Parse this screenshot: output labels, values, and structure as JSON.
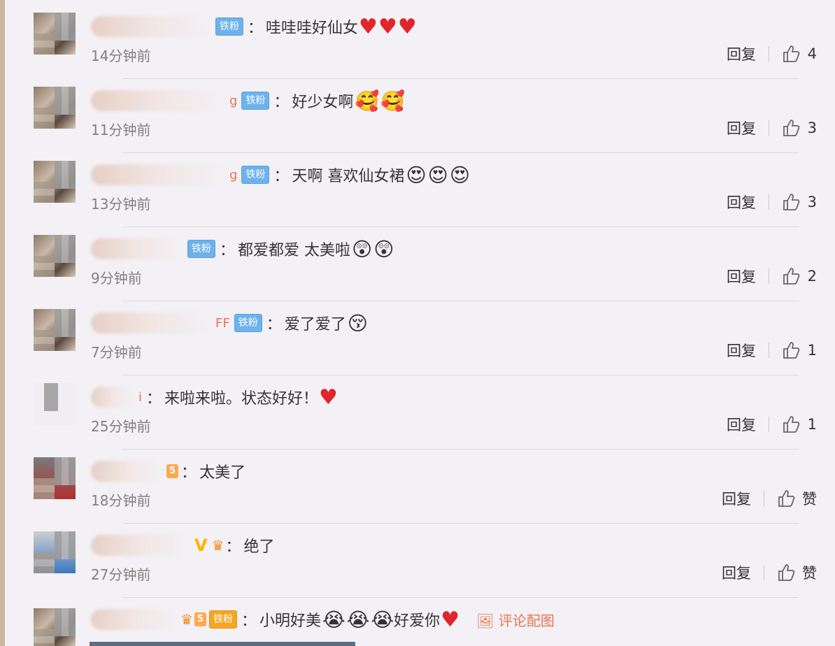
{
  "comments": [
    {
      "name_tail": "",
      "badges": [
        "铁粉"
      ],
      "text": "哇哇哇好仙女",
      "emojis": [
        "heart",
        "heart",
        "heart"
      ],
      "time": "14分钟前",
      "reply": "回复",
      "likes": "4"
    },
    {
      "name_tail": "g",
      "badges": [
        "铁粉"
      ],
      "text": "好少女啊",
      "emojis": [
        "love-face",
        "love-face"
      ],
      "time": "11分钟前",
      "reply": "回复",
      "likes": "3"
    },
    {
      "name_tail": "g",
      "badges": [
        "铁粉"
      ],
      "text": "天啊 喜欢仙女裙",
      "emojis": [
        "heart-eyes",
        "heart-eyes",
        "heart-eyes"
      ],
      "time": "13分钟前",
      "reply": "回复",
      "likes": "3"
    },
    {
      "name_tail": "",
      "badges": [
        "铁粉"
      ],
      "text": "都爱都爱 太美啦",
      "emojis": [
        "surprised",
        "surprised"
      ],
      "time": "9分钟前",
      "reply": "回复",
      "likes": "2"
    },
    {
      "name_tail": "FF",
      "badges": [
        "铁粉"
      ],
      "text": "爱了爱了",
      "emojis": [
        "kiss"
      ],
      "time": "7分钟前",
      "reply": "回复",
      "likes": "1"
    },
    {
      "name_tail": "i",
      "badges": [],
      "text": "来啦来啦。状态好好！",
      "emojis": [
        "heart"
      ],
      "time": "25分钟前",
      "reply": "回复",
      "likes": "1"
    },
    {
      "name_tail": "",
      "badges": [
        "5"
      ],
      "text": "太美了",
      "emojis": [],
      "time": "18分钟前",
      "reply": "回复",
      "likes": "赞"
    },
    {
      "name_tail": "",
      "badges": [
        "V",
        "crown"
      ],
      "text": "绝了",
      "emojis": [],
      "time": "27分钟前",
      "reply": "回复",
      "likes": "赞"
    },
    {
      "name_tail": "",
      "badges": [
        "crown5",
        "铁粉"
      ],
      "text": "小明好美",
      "emojis": [
        "cry",
        "cry",
        "cry"
      ],
      "text_after": "好爱你",
      "emojis_after": [
        "heart"
      ],
      "pic_link": "评论配图",
      "time": "",
      "reply": "",
      "likes": ""
    }
  ],
  "badge_labels": {
    "tiefen": "铁粉",
    "level": "5",
    "v": "V"
  },
  "colon": "：",
  "colors": {
    "heart": "#e0252b",
    "tiefen_badge": "#6eb2ec",
    "name_highlight": "#eb7350",
    "time": "#808080"
  }
}
